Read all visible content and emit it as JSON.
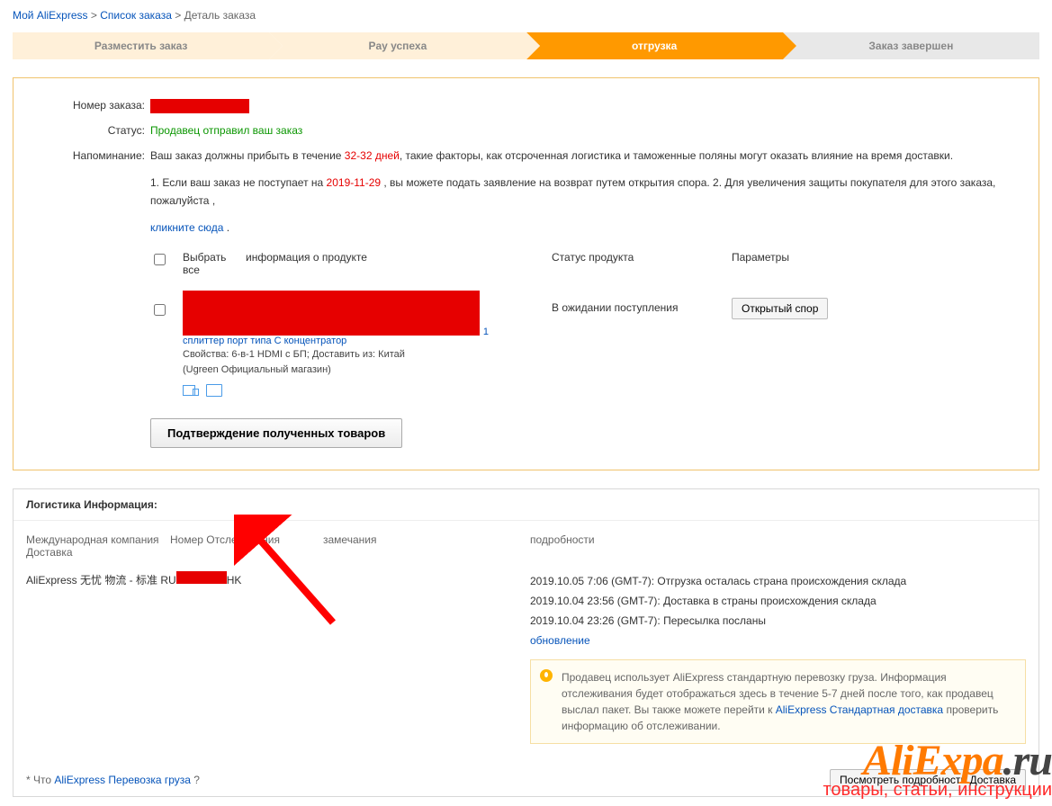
{
  "breadcrumb": {
    "my": "Мой AliExpress",
    "list": "Список заказа",
    "detail": "Деталь заказа",
    "sep": ">"
  },
  "steps": {
    "s1": "Разместить заказ",
    "s2": "Pay успеха",
    "s3": "отгрузка",
    "s4": "Заказ завершен"
  },
  "order": {
    "number_label": "Номер заказа:",
    "status_label": "Статус:",
    "status_value": "Продавец отправил ваш заказ",
    "reminder_label": "Напоминание:",
    "reminder_text1a": "Ваш заказ должны прибыть в течение ",
    "reminder_days": "32-32 дней",
    "reminder_text1b": ", такие факторы, как отсроченная логистика и таможенные поляны могут оказать влияние на время доставки.",
    "reminder_text2a": "1. Если ваш заказ не поступает на ",
    "reminder_date": "2019-11-29",
    "reminder_text2b": " , вы можете подать заявление на возврат путем открытия спора. 2. Для увеличения защиты покупателя для этого заказа, пожалуйста ,",
    "click_here": "кликните сюда",
    "dot": " ."
  },
  "table": {
    "select_all": "Выбрать все",
    "product_info": "информация о продукте",
    "product_status": "Статус продукта",
    "parameters": "Параметры",
    "row_qty": "1",
    "product_link_line": "сплиттер порт типа C концентратор",
    "product_props": "Свойства: 6-в-1 HDMI с БП; Доставить из: Китай",
    "product_shop": "(Ugreen Официальный магазин)",
    "waiting": "В ожидании поступления",
    "open_dispute": "Открытый спор",
    "confirm_btn": "Подтверждение полученных товаров"
  },
  "logistics": {
    "title": "Логистика Информация:",
    "col_company": "Международная компания Доставка",
    "col_tracking": "Номер Отслеживания",
    "col_notes": "замечания",
    "col_details": "подробности",
    "company_value": "AliExpress 无忧 物流 - 标准",
    "tracking_prefix": "RU",
    "tracking_suffix": "HK",
    "events": [
      "2019.10.05 7:06 (GMT-7): Отгрузка осталась страна происхождения склада",
      "2019.10.04 23:56 (GMT-7): Доставка в страны происхождения склада",
      "2019.10.04 23:26 (GMT-7): Пересылка посланы"
    ],
    "update": "обновление",
    "notice_a": "Продавец использует AliExpress стандартную перевозку груза. Информация отслеживания будет отображаться здесь в течение 5-7 дней после того, как продавец выслал пакет. Вы также можете перейти к ",
    "notice_link": "AliExpress Стандартная доставка",
    "notice_b": " проверить информацию об отслеживании."
  },
  "footer": {
    "what_prefix": "* Что ",
    "what_link": "AliExpress Перевозка груза",
    "what_suffix": " ?",
    "view_details_btn": "Посмотреть подробности Доставка"
  },
  "watermark": {
    "main_a": "AliExpa",
    "main_b": ".ru",
    "sub": "товары, статьи, инструкции"
  }
}
